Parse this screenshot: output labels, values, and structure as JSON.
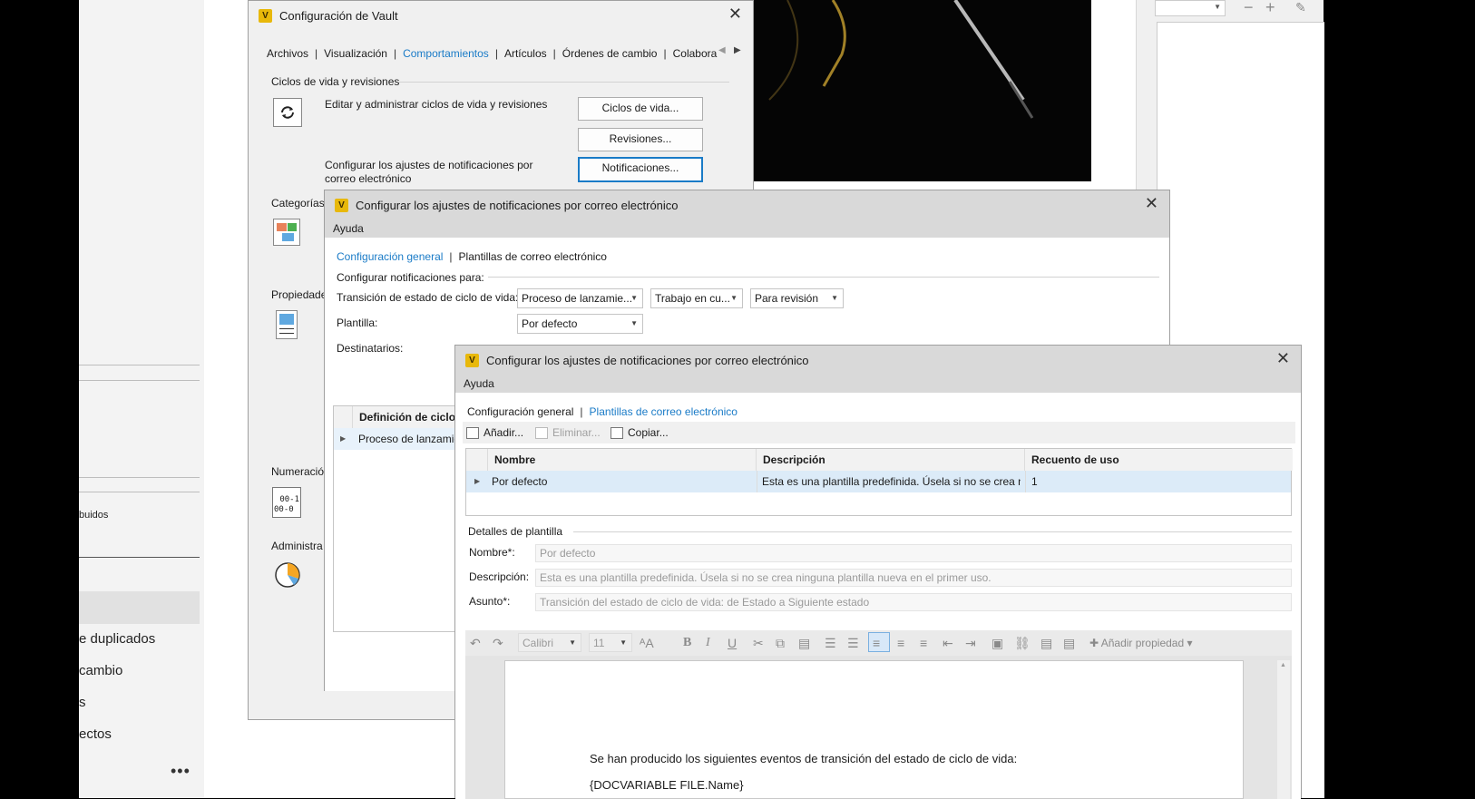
{
  "left_panel": {
    "items": [
      "buidos",
      "e duplicados",
      "cambio",
      "s",
      "ectos"
    ],
    "more": "•••"
  },
  "vault_dialog": {
    "title": "Configuración de Vault",
    "tabs": [
      "Archivos",
      "Visualización",
      "Comportamientos",
      "Artículos",
      "Órdenes de cambio",
      "Colabora"
    ],
    "active_tab": "Comportamientos",
    "section_lifecycle": "Ciclos de vida y revisiones",
    "edit_desc": "Editar y administrar ciclos de vida y revisiones",
    "notif_desc_1": "Configurar los ajustes de notificaciones por",
    "notif_desc_2": "correo electrónico",
    "btn_lifecycles": "Ciclos de vida...",
    "btn_revisions": "Revisiones...",
    "btn_notifications": "Notificaciones...",
    "section_categories": "Categorías",
    "section_properties": "Propiedade",
    "section_numbering": "Numeració",
    "section_admin": "Administra"
  },
  "notif_dialog_1": {
    "title": "Configurar los ajustes de notificaciones por correo electrónico",
    "menu_help": "Ayuda",
    "tab_general": "Configuración general",
    "tab_templates": "Plantillas de correo electrónico",
    "configure_for": "Configurar notificaciones para:",
    "transition_label": "Transición de estado de ciclo de vida:",
    "combo_process": "Proceso de lanzamie...",
    "combo_work": "Trabajo en cu...",
    "combo_review": "Para revisión",
    "template_label": "Plantilla:",
    "template_value": "Por defecto",
    "recipients_label": "Destinatarios:",
    "grid_header": "Definición de ciclo d",
    "grid_row": "Proceso de lanzamie"
  },
  "notif_dialog_2": {
    "title": "Configurar los ajustes de notificaciones por correo electrónico",
    "menu_help": "Ayuda",
    "tab_general": "Configuración general",
    "tab_templates": "Plantillas de correo electrónico",
    "toolbar": {
      "add": "Añadir...",
      "delete": "Eliminar...",
      "copy": "Copiar..."
    },
    "columns": [
      "Nombre",
      "Descripción",
      "Recuento de uso"
    ],
    "rows": [
      {
        "name": "Por defecto",
        "description": "Esta es una plantilla predefinida. Úsela si no se crea ni...",
        "count": "1"
      }
    ],
    "details_title": "Detalles de plantilla",
    "name_label": "Nombre*:",
    "name_value": "Por defecto",
    "desc_label": "Descripción:",
    "desc_value": "Esta es una plantilla predefinida. Úsela si no se crea ninguna plantilla nueva en el primer uso.",
    "subject_label": "Asunto*:",
    "subject_value": "Transición del estado de ciclo de vida: de Estado a Siguiente estado",
    "editor": {
      "font": "Calibri",
      "size": "11",
      "add_property": "Añadir propiedad",
      "body_line1": "Se han producido los siguientes eventos de transición del estado de ciclo de vida:",
      "body_line2": "{DOCVARIABLE FILE.Name}"
    }
  }
}
